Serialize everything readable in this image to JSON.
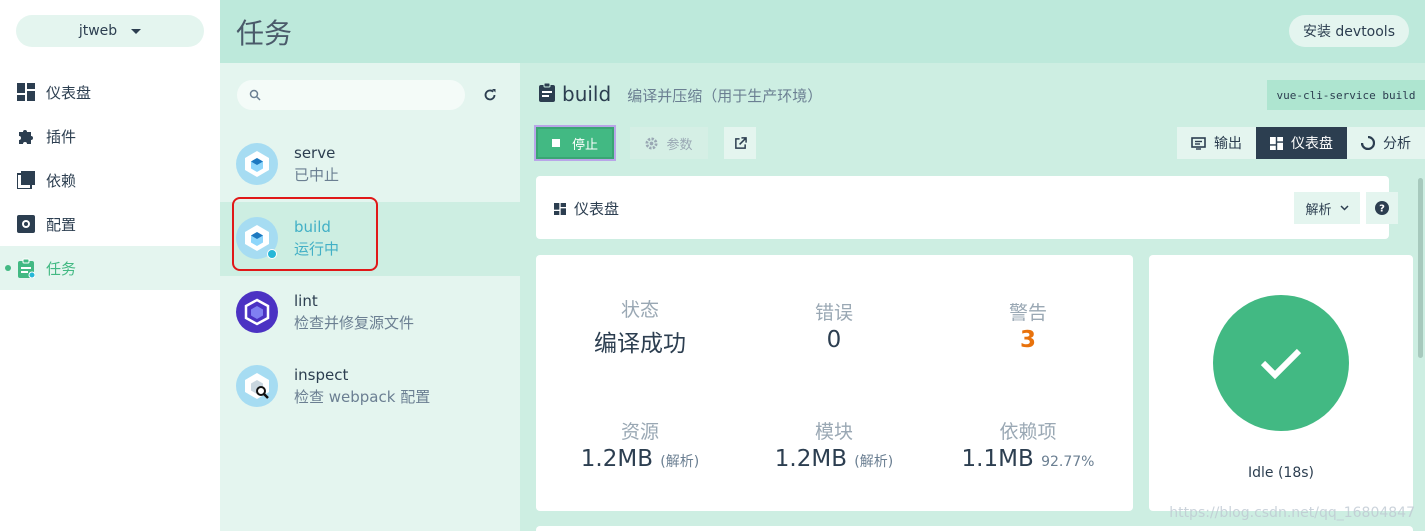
{
  "project": {
    "name": "jtweb"
  },
  "nav": [
    {
      "label": "仪表盘",
      "icon": "dashboard-icon",
      "active": false
    },
    {
      "label": "插件",
      "icon": "puzzle-icon",
      "active": false
    },
    {
      "label": "依赖",
      "icon": "library-icon",
      "active": false
    },
    {
      "label": "配置",
      "icon": "settings-icon",
      "active": false
    },
    {
      "label": "任务",
      "icon": "assignment-icon",
      "active": true
    }
  ],
  "header": {
    "title": "任务",
    "devtools_label": "安装 devtools"
  },
  "search": {
    "placeholder": ""
  },
  "tasks": [
    {
      "name": "serve",
      "status": "已中止",
      "icon": "webpack-icon",
      "active": false
    },
    {
      "name": "build",
      "status": "运行中",
      "icon": "webpack-icon",
      "active": true
    },
    {
      "name": "lint",
      "status": "检查并修复源文件",
      "icon": "eslint-icon",
      "active": false
    },
    {
      "name": "inspect",
      "status": "检查 webpack 配置",
      "icon": "webpack-inspect-icon",
      "active": false
    }
  ],
  "current_task": {
    "name": "build",
    "description": "编译并压缩（用于生产环境）",
    "command": "vue-cli-service build"
  },
  "actions": {
    "stop": "停止",
    "params": "参数"
  },
  "view_tabs": [
    {
      "label": "输出",
      "icon": "output-icon",
      "active": false
    },
    {
      "label": "仪表盘",
      "icon": "dashboard-icon",
      "active": true
    },
    {
      "label": "分析",
      "icon": "analyze-icon",
      "active": false
    }
  ],
  "dashboard": {
    "title": "仪表盘",
    "analyze_dropdown": "解析",
    "stats": {
      "status": {
        "label": "状态",
        "value": "编译成功"
      },
      "errors": {
        "label": "错误",
        "value": "0"
      },
      "warnings": {
        "label": "警告",
        "value": "3"
      },
      "assets": {
        "label": "资源",
        "value": "1.2MB",
        "sub": "(解析)"
      },
      "modules": {
        "label": "模块",
        "value": "1.2MB",
        "sub": "(解析)"
      },
      "deps": {
        "label": "依赖项",
        "value": "1.1MB",
        "sub": "92.77%"
      }
    },
    "idle_text": "Idle (18s)"
  },
  "watermark": "https://blog.csdn.net/qq_16804847",
  "colors": {
    "accent": "#42b983",
    "header": "#bde9db",
    "warning": "#e8720c",
    "dark": "#2c3e50"
  }
}
